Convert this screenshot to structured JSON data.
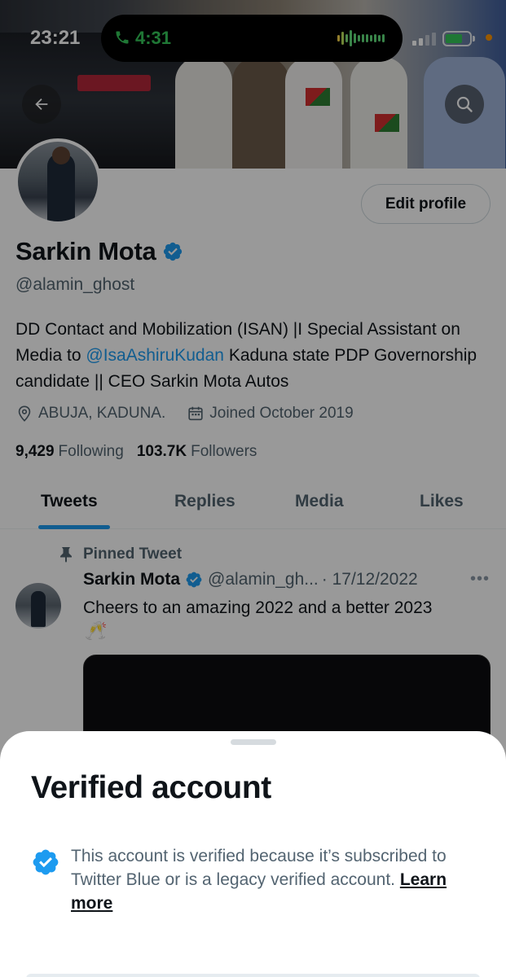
{
  "status_bar": {
    "time": "23:21",
    "call_duration": "4:31",
    "battery_level": 0.7
  },
  "profile": {
    "name": "Sarkin Mota",
    "handle": "@alamin_ghost",
    "edit_profile_label": "Edit profile",
    "bio": {
      "part1": "DD Contact and Mobilization (ISAN) |I Special Assistant on Media to ",
      "mention": "@IsaAshiruKudan",
      "part2": " Kaduna state PDP Governorship candidate || CEO Sarkin Mota Autos"
    },
    "location": "ABUJA, KADUNA.",
    "joined": "Joined October 2019",
    "following_count": "9,429",
    "following_label": "Following",
    "followers_count": "103.7K",
    "followers_label": "Followers"
  },
  "tabs": [
    {
      "label": "Tweets",
      "active": true
    },
    {
      "label": "Replies",
      "active": false
    },
    {
      "label": "Media",
      "active": false
    },
    {
      "label": "Likes",
      "active": false
    }
  ],
  "pinned_tweet": {
    "pinned_label": "Pinned Tweet",
    "author_name": "Sarkin Mota",
    "author_handle": "@alamin_gh...",
    "date": "· 17/12/2022",
    "more": "•••",
    "text": "Cheers to an amazing 2022 and a better 2023",
    "emoji": "🥂"
  },
  "sheet": {
    "title": "Verified account",
    "description": "This account is verified because it’s subscribed to Twitter Blue or is a legacy verified account. ",
    "learn_more": "Learn more"
  },
  "colors": {
    "accent": "#1d9bf0",
    "text_primary": "#0f1419",
    "text_secondary": "#536471",
    "call_green": "#34c759"
  },
  "icons": {
    "back": "arrow-left-icon",
    "search": "search-icon",
    "verified": "verified-badge-icon",
    "location": "location-pin-icon",
    "calendar": "calendar-icon",
    "pin": "pin-icon",
    "phone": "phone-icon"
  }
}
